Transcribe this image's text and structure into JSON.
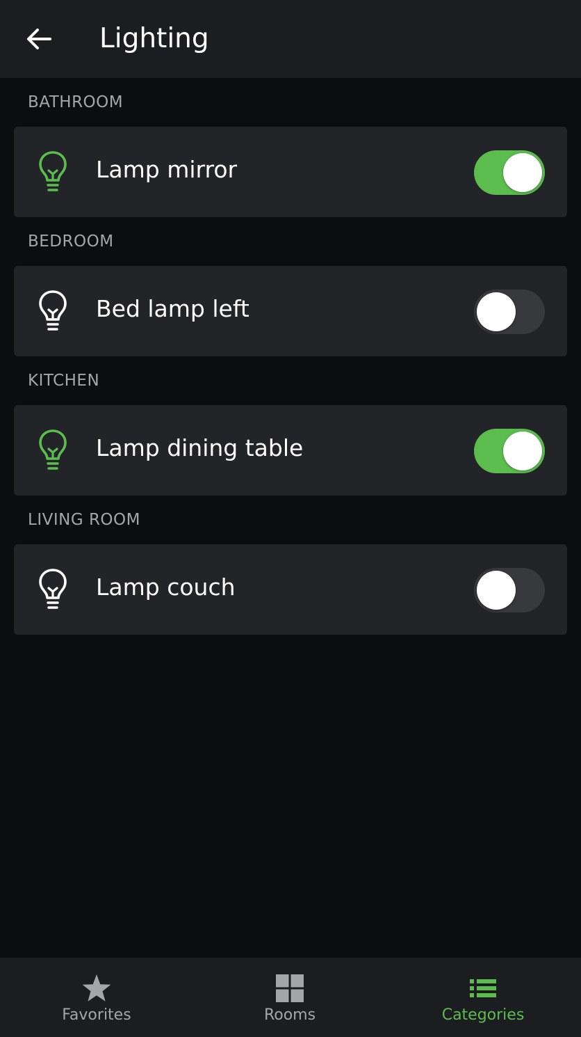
{
  "header": {
    "title": "Lighting",
    "back_icon": "arrow-left-icon"
  },
  "colors": {
    "accent": "#5cbd4f",
    "background": "#0c0d0f",
    "card": "#232427",
    "header": "#1c1d20",
    "muted_text": "#a4a6a9"
  },
  "sections": [
    {
      "label": "BATHROOM",
      "device": {
        "name": "Lamp mirror",
        "icon": "lightbulb-icon",
        "on": true
      }
    },
    {
      "label": "BEDROOM",
      "device": {
        "name": "Bed lamp left",
        "icon": "lightbulb-icon",
        "on": false
      }
    },
    {
      "label": "KITCHEN",
      "device": {
        "name": "Lamp dining table",
        "icon": "lightbulb-icon",
        "on": true
      }
    },
    {
      "label": "LIVING ROOM",
      "device": {
        "name": "Lamp couch",
        "icon": "lightbulb-icon",
        "on": false
      }
    }
  ],
  "bottom_nav": {
    "items": [
      {
        "label": "Favorites",
        "icon": "star-icon",
        "active": false
      },
      {
        "label": "Rooms",
        "icon": "grid-icon",
        "active": false
      },
      {
        "label": "Categories",
        "icon": "list-icon",
        "active": true
      }
    ]
  }
}
